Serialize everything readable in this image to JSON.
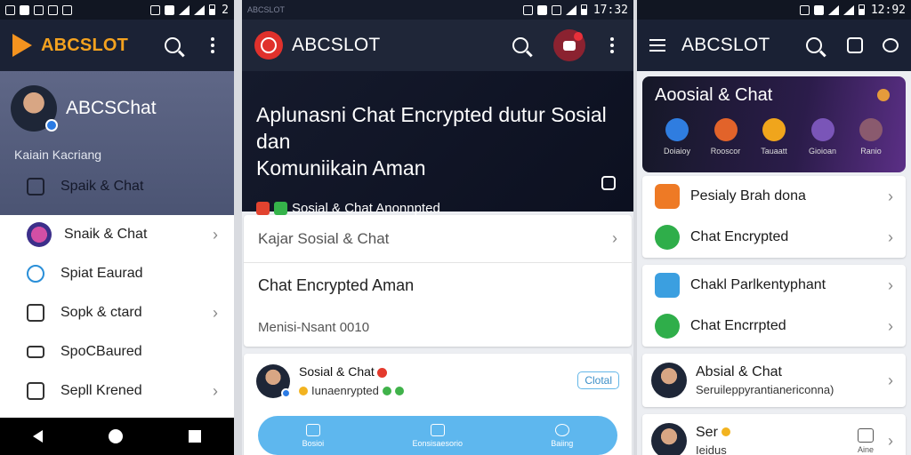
{
  "colors": {
    "header_dark": "#1b2235",
    "drawer_bg": "#5f6787",
    "accent_orange": "#f4a21f",
    "accent_red": "#e0312c",
    "tab_blue": "#5eb7ee"
  },
  "screen1": {
    "status_time": "2",
    "brand": "ABCSLOT",
    "drawer_name": "ABCSChat",
    "drawer_sub": "Kaiain Kacriang",
    "active_item": "Spaik & Chat",
    "items": [
      {
        "label": "Snaik & Chat",
        "icon": "user-avatar-icon"
      },
      {
        "label": "Spiat Eaurad",
        "icon": "heart-chat-icon"
      },
      {
        "label": "Sopk & ctard",
        "icon": "bookmark-icon"
      },
      {
        "label": "SpoCBaured",
        "icon": "card-icon"
      },
      {
        "label": "Sepll Krened",
        "icon": "timer-icon"
      }
    ]
  },
  "screen2": {
    "faint_label": "ABCSLOT",
    "status_time": "17:32",
    "brand": "ABCSLOT",
    "hero_title_line1": "Aplunasni Chat Encrypted dutur Sosial dan",
    "hero_title_line2": "Komuniikain Aman",
    "hero_tag": "Sosial & Chat Anonnpted",
    "row1": "Kajar Sosial & Chat",
    "row2": "Chat Encrypted Aman",
    "row3": "Menisi-Nsant 0010",
    "chat_name": "Sosial & Chat",
    "chat_sub": "Iunaenrypted",
    "chat_chip": "Clotal",
    "tabs": [
      "Bosioi",
      "Eonsisaesorio",
      "Baiing"
    ]
  },
  "screen3": {
    "status_time": "12:92",
    "brand": "ABCSLOT",
    "promo_title": "Aoosial & Chat",
    "promo_icons": [
      {
        "label": "Doiaioy",
        "color": "#2f7de0"
      },
      {
        "label": "Rooscor",
        "color": "#e2632a"
      },
      {
        "label": "Tauaatt",
        "color": "#f0a51c"
      },
      {
        "label": "Gioioan",
        "color": "#7a55b8"
      },
      {
        "label": "Ranio",
        "color": "#8a5a6e"
      }
    ],
    "group1": [
      {
        "label": "Pesialy Brah dona",
        "color": "#ee7a25"
      },
      {
        "label": "Chat Encrypted",
        "color": "#2fae4a"
      }
    ],
    "group2": [
      {
        "label": "Chakl Parlkentyphant",
        "color": "#3b9fe0"
      },
      {
        "label": "Chat Encrrpted",
        "color": "#2fae4a"
      }
    ],
    "row_a_title": "Absial & Chat",
    "row_a_sub": "Seruileppyrantianericonna)",
    "row_b_title": "Ser",
    "row_b_sub": "Ieidus",
    "row_b_aux": "Aine"
  }
}
